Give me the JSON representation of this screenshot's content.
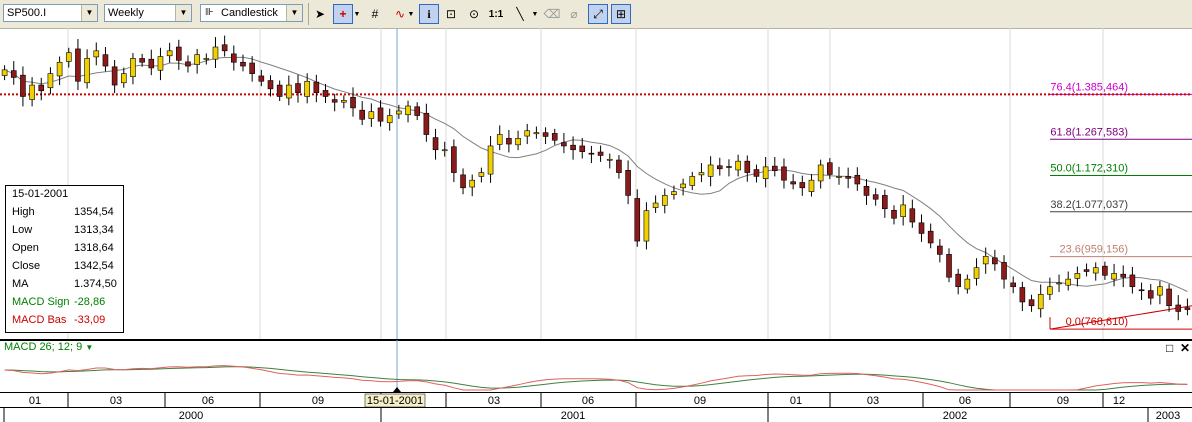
{
  "toolbar": {
    "symbol": "SP500.I",
    "interval": "Weekly",
    "chart_type": "Candlestick",
    "icons": [
      "pointer-icon",
      "crosshair-icon",
      "grid-icon",
      "indicator-icon",
      "info-icon",
      "zoom-area-icon",
      "zoom-icon",
      "one-to-one-icon",
      "line-draw-icon",
      "eraser-icon",
      "trash-icon",
      "autoscale-icon",
      "pattern-icon"
    ],
    "scale_label": "1:1"
  },
  "info_box": {
    "date": "15-01-2001",
    "rows": [
      {
        "label": "High",
        "value": "1354,54",
        "color": "#000000"
      },
      {
        "label": "Low",
        "value": "1313,34",
        "color": "#000000"
      },
      {
        "label": "Open",
        "value": "1318,64",
        "color": "#000000"
      },
      {
        "label": "Close",
        "value": "1342,54",
        "color": "#000000"
      },
      {
        "label": "MA",
        "value": "1.374,50",
        "color": "#000000"
      },
      {
        "label": "MACD Sign",
        "value": "-28,86",
        "color": "#008000"
      },
      {
        "label": "MACD Bas",
        "value": "-33,09",
        "color": "#cc0000"
      }
    ]
  },
  "macd_legend": "MACD 26; 12; 9",
  "cursor_date": "15-01-2001",
  "fib_levels": [
    {
      "label": "76.4(1.385,464)",
      "value": 1385.464,
      "color": "#cc00cc"
    },
    {
      "label": "61.8(1.267,583)",
      "value": 1267.583,
      "color": "#800080"
    },
    {
      "label": "50.0(1.172,310)",
      "value": 1172.31,
      "color": "#008000"
    },
    {
      "label": "38.2(1.077,037)",
      "value": 1077.037,
      "color": "#404040"
    },
    {
      "label": "23.6(959,156)",
      "value": 959.156,
      "color": "#c08070"
    },
    {
      "label": "0.0(768,610)",
      "value": 768.61,
      "color": "#cc0000"
    }
  ],
  "colors": {
    "up": "#f0d000",
    "down": "#8b1a1a",
    "ma": "#808080",
    "macd": "#e06060",
    "signal": "#408040",
    "hline": "#cc0000"
  },
  "chart_data": {
    "type": "candlestick",
    "symbol": "SP500.I",
    "interval": "Weekly",
    "ylim": [
      740,
      1560
    ],
    "x_month_ticks": [
      "01",
      "03",
      "06",
      "09",
      "15-01-2001",
      "03",
      "06",
      "09",
      "01",
      "03",
      "06",
      "09",
      "12"
    ],
    "x_year_ticks": [
      "2000",
      "2001",
      "2002",
      "2003"
    ],
    "close_series": [
      1450,
      1430,
      1380,
      1410,
      1395,
      1440,
      1470,
      1495,
      1420,
      1480,
      1500,
      1460,
      1410,
      1440,
      1480,
      1470,
      1455,
      1485,
      1500,
      1475,
      1460,
      1490,
      1480,
      1510,
      1500,
      1470,
      1460,
      1440,
      1420,
      1400,
      1380,
      1410,
      1390,
      1420,
      1390,
      1380,
      1365,
      1370,
      1350,
      1320,
      1340,
      1315,
      1330,
      1342,
      1355,
      1330,
      1280,
      1240,
      1240,
      1180,
      1140,
      1160,
      1180,
      1250,
      1280,
      1255,
      1270,
      1290,
      1285,
      1275,
      1265,
      1250,
      1240,
      1235,
      1230,
      1225,
      1215,
      1180,
      1120,
      1000,
      1080,
      1100,
      1120,
      1130,
      1150,
      1170,
      1180,
      1200,
      1190,
      1195,
      1210,
      1180,
      1170,
      1195,
      1185,
      1160,
      1150,
      1140,
      1160,
      1200,
      1175,
      1170,
      1165,
      1150,
      1120,
      1110,
      1085,
      1060,
      1095,
      1050,
      1020,
      995,
      965,
      905,
      880,
      900,
      930,
      960,
      940,
      900,
      880,
      840,
      830,
      860,
      880,
      890,
      900,
      915,
      920,
      930,
      910,
      915,
      905,
      880,
      870,
      850,
      880,
      830,
      815,
      820
    ]
  }
}
